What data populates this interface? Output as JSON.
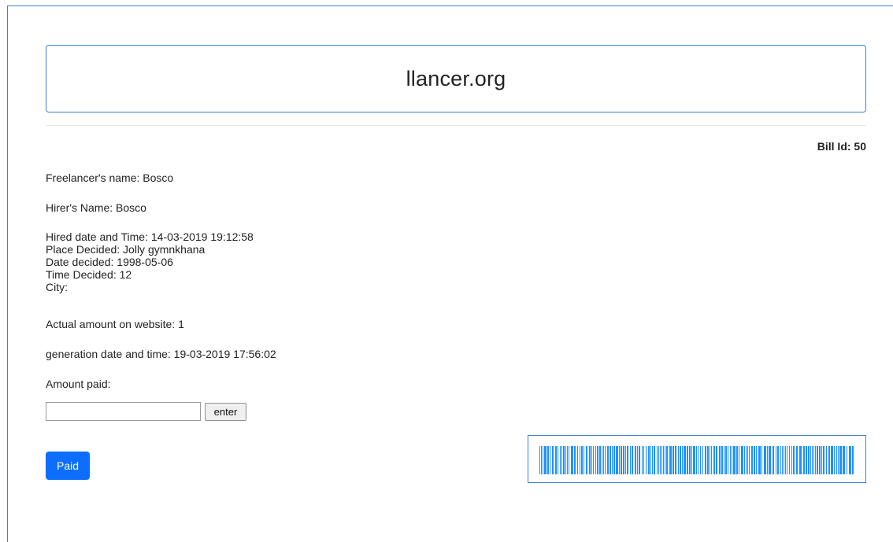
{
  "header": {
    "site_title": "llancer.org"
  },
  "bill": {
    "bill_id_text": "Bill Id: 50",
    "freelancer_name": "Freelancer's name: Bosco",
    "hirer_name": "Hirer's Name: Bosco",
    "hired_datetime": "Hired date and Time: 14-03-2019 19:12:58",
    "place_decided": "Place Decided: Jolly gymnkhana",
    "date_decided": "Date decided: 1998-05-06",
    "time_decided": "Time Decided: 12",
    "city": "City:",
    "actual_amount": "Actual amount on website: 1",
    "generation_datetime": "generation date and time: 19-03-2019 17:56:02",
    "amount_paid_label": "Amount paid:"
  },
  "form": {
    "amount_input_value": "",
    "amount_input_placeholder": "",
    "enter_label": "enter",
    "paid_label": "Paid"
  },
  "barcode": {
    "color": "#1e90ff"
  },
  "colors": {
    "accent_border": "#3b7fd6",
    "primary_button": "#0d6efd"
  }
}
